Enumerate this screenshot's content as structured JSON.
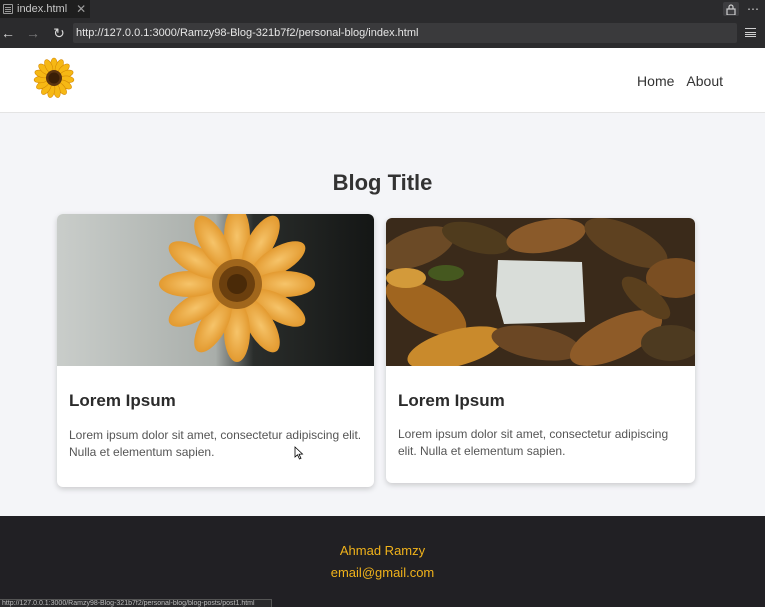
{
  "browser": {
    "tab_title": "index.html",
    "tab_close": "✕",
    "url": "http://127.0.0.1:3000/Ramzy98-Blog-321b7f2/personal-blog/index.html",
    "more": "⋯",
    "back": "←",
    "forward": "→",
    "reload": "↻",
    "status_url": "http://127.0.0.1:3000/Ramzy98-Blog-321b7f2/personal-blog/blog-posts/post1.html"
  },
  "site": {
    "nav": [
      {
        "label": "Home"
      },
      {
        "label": "About"
      }
    ],
    "page_title": "Blog Title",
    "posts": [
      {
        "title": "Lorem Ipsum",
        "text": "Lorem ipsum dolor sit amet, consectetur adipiscing elit. Nulla et elementum sapien."
      },
      {
        "title": "Lorem Ipsum",
        "text": "Lorem ipsum dolor sit amet, consectetur adipiscing elit. Nulla et elementum sapien."
      }
    ],
    "footer": {
      "name": "Ahmad Ramzy",
      "email": "email@gmail.com"
    }
  },
  "colors": {
    "accent": "#f0b21b",
    "footer_bg": "#212024",
    "page_bg": "#f4f5f8"
  }
}
